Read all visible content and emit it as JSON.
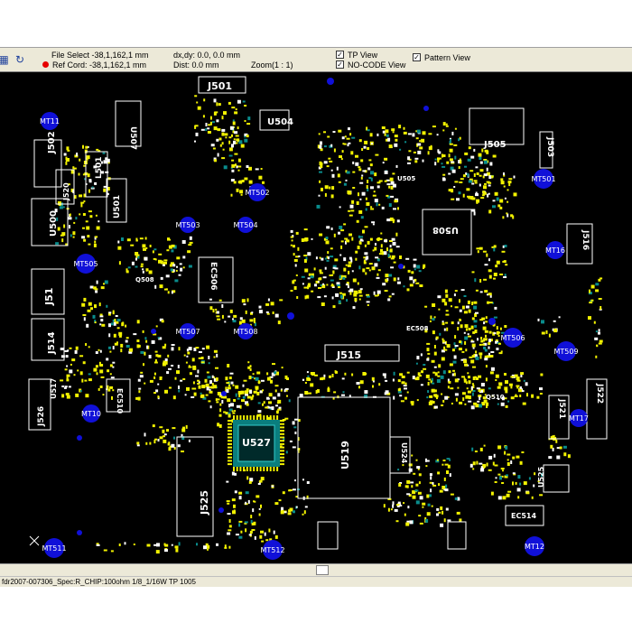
{
  "toolbar": {
    "file_select": "File Select -38,1,162,1 mm",
    "ref_cord": "Ref Cord: -38,1,162,1 mm",
    "dxdy": "dx,dy: 0.0, 0.0 mm",
    "dist": "Dist: 0.0 mm",
    "zoom": "Zoom(1 : 1)",
    "tp_view": "TP View",
    "no_code_view": "NO-CODE View",
    "pattern_view": "Pattern View",
    "refresh_icon": "refresh-icon",
    "grid_icon": "grid-icon"
  },
  "colors": {
    "board_bg": "#000000",
    "pad_yellow": "#f2f200",
    "pad_white": "#ffffff",
    "chip_teal": "#0a8c8c",
    "test_point_blue": "#1010d8"
  },
  "components": {
    "j501": "J501",
    "u507": "U507",
    "j502": "J502",
    "u504": "U504",
    "j505": "J505",
    "j503": "J503",
    "j520": "J520",
    "l501": "L501",
    "u501": "U501",
    "u500": "U500",
    "u505": "U505",
    "u508": "U508",
    "j516": "J516",
    "j51": "J51",
    "ec506": "EC506",
    "j514": "J514",
    "j515": "J515",
    "u519": "U519",
    "u527": "U527",
    "j525": "J525",
    "j522": "J522",
    "j521": "J521",
    "u517": "U517",
    "ec510": "EC510",
    "j526": "J526",
    "q510": "Q510",
    "ec514": "EC514",
    "u525": "U525",
    "u524": "U524",
    "ec508": "EC508",
    "q508": "Q508"
  },
  "test_points": {
    "mt11": "MT11",
    "mt502": "MT502",
    "mt501": "MT501",
    "mt16": "MT16",
    "mt505": "MT505",
    "mt506": "MT506",
    "mt509": "MT509",
    "mt10": "MT10",
    "mt17": "MT17",
    "mt511": "MT511",
    "mt512": "MT512",
    "mt12": "MT12",
    "mt503": "MT503",
    "mt504": "MT504",
    "mt508": "MT508",
    "mt507": "MT507"
  },
  "status": {
    "text": "fdr2007-007306_Spec:R_CHIP:100ohm 1/8_1/16W TP 1005"
  }
}
